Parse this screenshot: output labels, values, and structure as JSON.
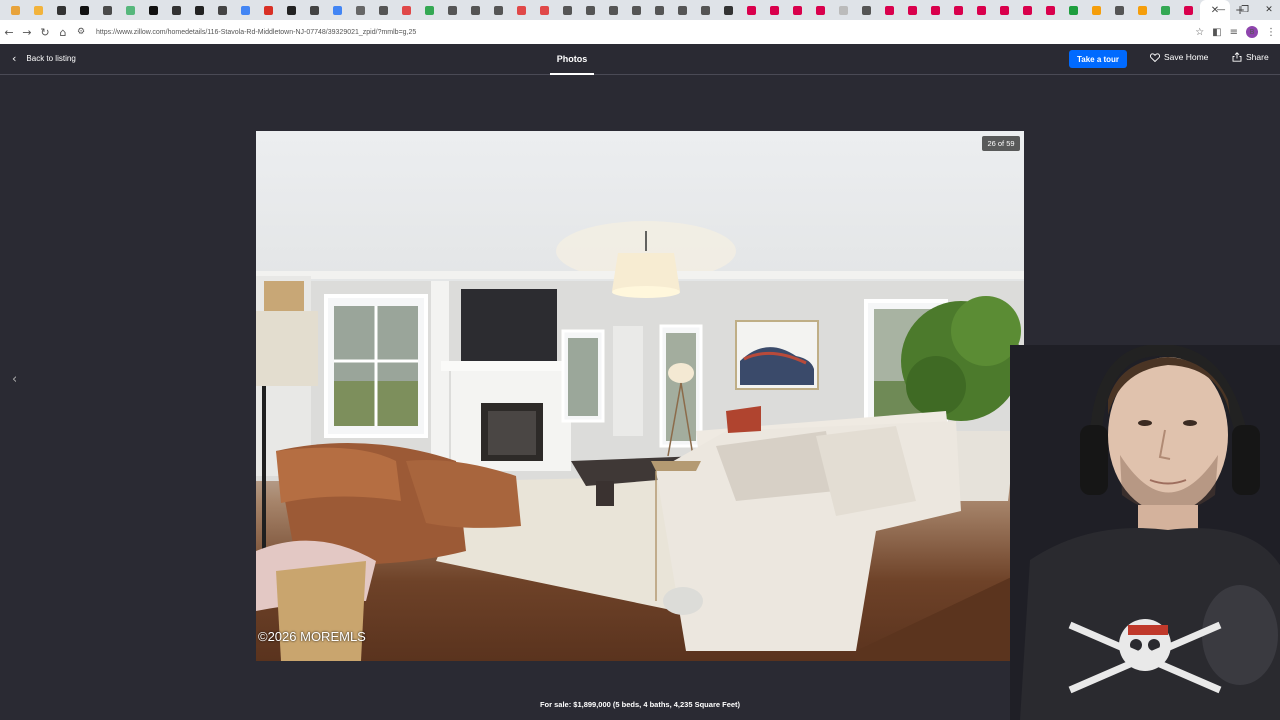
{
  "browser": {
    "url": "https://www.zillow.com/homedetails/116-Stavola-Rd-Middletown-NJ-07748/39329021_zpid/?mmlb=g,25",
    "tab_favicon_colors": [
      "#e8a33b",
      "#f2b33b",
      "#333333",
      "#111111",
      "#4a4a4a",
      "#56b77c",
      "#111111",
      "#333333",
      "#222222",
      "#444444",
      "#4285f4",
      "#d93025",
      "#222222",
      "#444444",
      "#4285f4",
      "#666666",
      "#555555",
      "#e04848",
      "#34a853",
      "#555555",
      "#555555",
      "#555555",
      "#e04848",
      "#e04848",
      "#555555",
      "#555555",
      "#555555",
      "#555555",
      "#555555",
      "#555555",
      "#555555",
      "#333333",
      "#d9004c",
      "#d9004c",
      "#d9004c",
      "#d9004c",
      "#bbbbbb",
      "#555555",
      "#d9004c",
      "#d9004c",
      "#d9004c",
      "#d9004c",
      "#d9004c",
      "#d9004c",
      "#d9004c",
      "#d9004c",
      "#1e9e3e",
      "#f59e0b",
      "#555555",
      "#f59e0b",
      "#34a853",
      "#d9004c"
    ],
    "profile_initial": "B"
  },
  "header": {
    "back_label": "Back to listing",
    "active_tab": "Photos",
    "tour_button": "Take a tour",
    "save_label": "Save Home",
    "share_label": "Share"
  },
  "viewer": {
    "counter": "26 of 59",
    "watermark": "©2026 MOREMLS",
    "caption": "For sale: $1,899,000 (5 beds, 4 baths, 4,235 Square Feet)"
  },
  "colors": {
    "accent": "#006aff",
    "background": "#2a2a33"
  }
}
